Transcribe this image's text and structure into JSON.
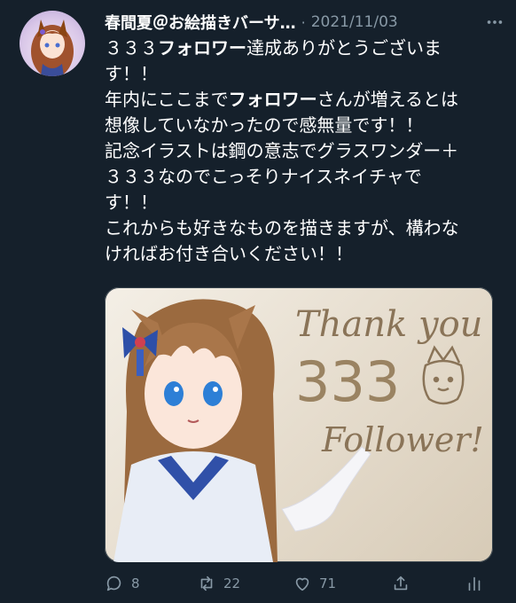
{
  "tweet": {
    "author_name": "春間夏＠お絵描きバーサ…",
    "separator": "·",
    "date": "2021/11/03",
    "text_lines": [
      [
        "３３３",
        "フォロワー",
        "達成ありがとうございま"
      ],
      [
        "す！！"
      ],
      [
        "年内にここまで",
        "フォロワー",
        "さんが増えるとは"
      ],
      [
        "想像していなかったので感無量です！！"
      ],
      [
        "記念イラストは鋼の意志でグラスワンダー＋"
      ],
      [
        "３３３なのでこっそりナイスネイチャで"
      ],
      [
        "す！！"
      ],
      [
        "これからも好きなものを描きますが、構わな"
      ],
      [
        "ければお付き合いください！！"
      ]
    ],
    "image_text": {
      "line1": "Thank you",
      "line2": "333",
      "line3": "Follower!"
    }
  },
  "actions": {
    "reply_count": "8",
    "retweet_count": "22",
    "like_count": "71"
  },
  "colors": {
    "background": "#15202b",
    "secondary_text": "#8899a6",
    "primary_text": "#ffffff"
  }
}
